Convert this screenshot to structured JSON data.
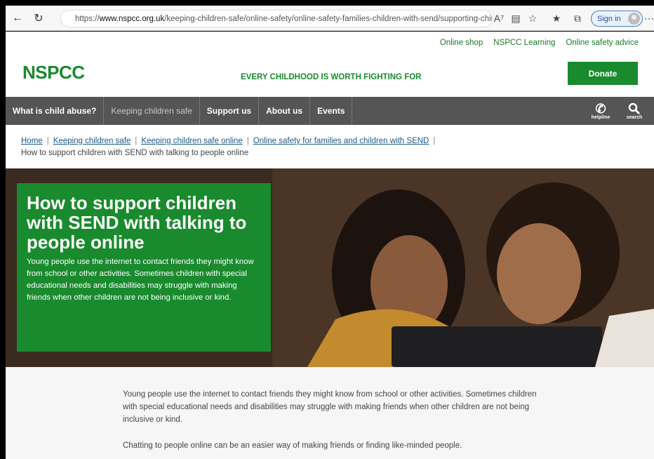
{
  "browser": {
    "url_prefix": "https://",
    "url_host": "www.nspcc.org.uk",
    "url_path": "/keeping-children-safe/online-safety/online-safety-families-children-with-send/supporting-children...",
    "signin_label": "Sign in"
  },
  "header": {
    "top_links": [
      "Online shop",
      "NSPCC Learning",
      "Online safety advice"
    ],
    "logo": "NSPCC",
    "tagline": "EVERY CHILDHOOD IS WORTH FIGHTING FOR",
    "donate_label": "Donate"
  },
  "nav": {
    "items": [
      "What is child abuse?",
      "Keeping children safe",
      "Support us",
      "About us",
      "Events"
    ],
    "helpline_label": "helpline",
    "search_label": "search"
  },
  "breadcrumb": {
    "links": [
      "Home",
      "Keeping children safe",
      "Keeping children safe online",
      "Online safety for families and children with SEND"
    ],
    "current": "How to support children with SEND with talking to people online"
  },
  "hero": {
    "title": "How to support children with SEND with talking to people online",
    "lead": "Young people use the internet to contact friends they might know from school or other activities. Sometimes children with special educational needs and disabilities may struggle with making friends when other children are not being inclusive or kind."
  },
  "content": {
    "paragraphs": [
      "Young people use the internet to contact friends they might know from school or other activities. Sometimes children with special educational needs and disabilities may struggle with making friends when other children are not being inclusive or kind.",
      "Chatting to people online can be an easier way of making friends or finding like-minded people."
    ]
  },
  "colors": {
    "brand_green": "#1a8a2e",
    "nav_grey": "#555555",
    "link_blue": "#1d5a87"
  }
}
